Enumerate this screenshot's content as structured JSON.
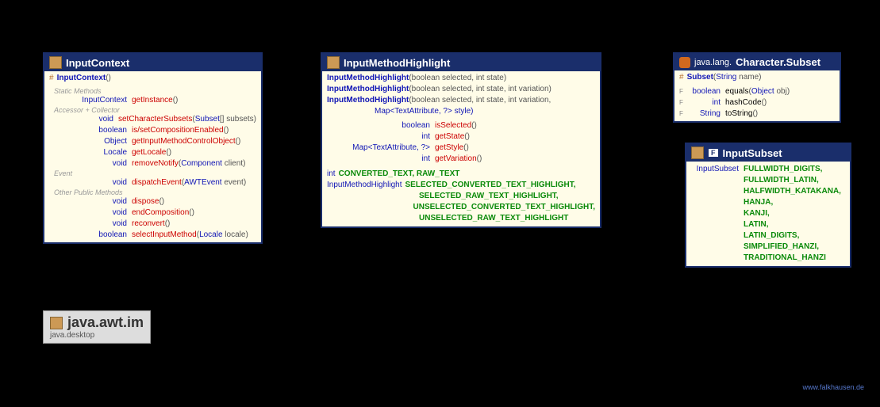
{
  "pkg": {
    "title": "java.awt.im",
    "module": "java.desktop"
  },
  "footer": "www.falkhausen.de",
  "box1": {
    "title": "InputContext",
    "ctor": "InputContext",
    "ctor_par": "()",
    "sec1": "Static Methods",
    "m1": {
      "ret": "InputContext",
      "name": "getInstance",
      "par": "()"
    },
    "sec2": "Accessor + Collector",
    "m2": {
      "ret": "void",
      "name": "setCharacterSubsets",
      "par": "(Subset[] subsets)",
      "t": "Subset"
    },
    "m3": {
      "ret": "boolean",
      "name": "is/setCompositionEnabled",
      "par": "()"
    },
    "m4": {
      "ret": "Object",
      "name": "getInputMethodControlObject",
      "par": "()"
    },
    "m5": {
      "ret": "Locale",
      "name": "getLocale",
      "par": "()"
    },
    "m6": {
      "ret": "void",
      "name": "removeNotify",
      "par": "(Component client)",
      "t": "Component"
    },
    "sec3": "Event",
    "m7": {
      "ret": "void",
      "name": "dispatchEvent",
      "par": "(AWTEvent event)",
      "t": "AWTEvent"
    },
    "sec4": "Other Public Methods",
    "m8": {
      "ret": "void",
      "name": "dispose",
      "par": "()"
    },
    "m9": {
      "ret": "void",
      "name": "endComposition",
      "par": "()"
    },
    "m10": {
      "ret": "void",
      "name": "reconvert",
      "par": "()"
    },
    "m11": {
      "ret": "boolean",
      "name": "selectInputMethod",
      "par": "(Locale locale)",
      "t": "Locale"
    }
  },
  "box2": {
    "title": "InputMethodHighlight",
    "c1": {
      "name": "InputMethodHighlight",
      "par": " (boolean selected, int state)"
    },
    "c2": {
      "name": "InputMethodHighlight",
      "par": " (boolean selected, int state, int variation)"
    },
    "c3": {
      "name": "InputMethodHighlight",
      "par": " (boolean selected, int state, int variation,"
    },
    "c3b": "Map<TextAttribute, ?> style)",
    "m1": {
      "ret": "boolean",
      "name": "isSelected",
      "par": "()"
    },
    "m2": {
      "ret": "int",
      "name": "getState",
      "par": "()"
    },
    "m3": {
      "ret": "Map<TextAttribute, ?>",
      "name": "getStyle",
      "par": "()"
    },
    "m4": {
      "ret": "int",
      "name": "getVariation",
      "par": "()"
    },
    "f1": {
      "ret": "int",
      "name": "CONVERTED_TEXT, RAW_TEXT"
    },
    "f2": {
      "ret": "InputMethodHighlight",
      "name": "SELECTED_CONVERTED_TEXT_HIGHLIGHT,"
    },
    "f3": "SELECTED_RAW_TEXT_HIGHLIGHT,",
    "f4": "UNSELECTED_CONVERTED_TEXT_HIGHLIGHT,",
    "f5": "UNSELECTED_RAW_TEXT_HIGHLIGHT"
  },
  "box3": {
    "pkg": "java.lang.",
    "title": "Character.Subset",
    "ctor": "Subset",
    "ctor_par": " (String name)",
    "ctor_t": "String",
    "m1": {
      "ret": "boolean",
      "name": "equals",
      "par": "(Object obj)",
      "t": "Object"
    },
    "m2": {
      "ret": "int",
      "name": "hashCode",
      "par": "()"
    },
    "m3": {
      "ret": "String",
      "name": "toString",
      "par": "()"
    }
  },
  "box4": {
    "title": "InputSubset",
    "badge": "F",
    "ret": "InputSubset",
    "f1": "FULLWIDTH_DIGITS,",
    "f2": "FULLWIDTH_LATIN,",
    "f3": "HALFWIDTH_KATAKANA,",
    "f4": "HANJA,",
    "f5": "KANJI,",
    "f6": "LATIN,",
    "f7": "LATIN_DIGITS,",
    "f8": "SIMPLIFIED_HANZI,",
    "f9": "TRADITIONAL_HANZI"
  }
}
